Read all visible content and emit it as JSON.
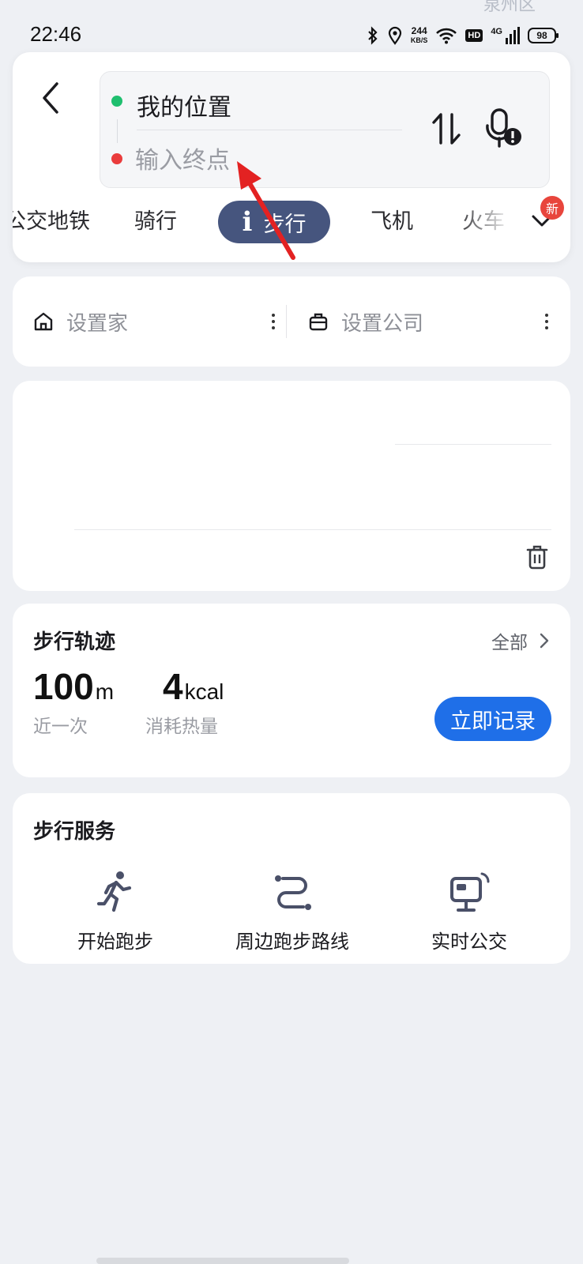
{
  "status_bar": {
    "time": "22:46",
    "speed_value": "244",
    "speed_unit": "KB/S",
    "hd": "HD",
    "network": "4G",
    "battery": "98"
  },
  "map_labels": [
    "泉州区"
  ],
  "route": {
    "from": "我的位置",
    "to_placeholder": "输入终点",
    "from_dot_color": "#1fbf6f",
    "to_dot_color": "#ea3c3c"
  },
  "tabs": {
    "items": [
      "公交地铁",
      "骑行",
      "步行",
      "飞机",
      "火车"
    ],
    "active": "步行",
    "new_badge": "新"
  },
  "shortcuts": {
    "home_label": "设置家",
    "company_label": "设置公司"
  },
  "walk_track": {
    "title": "步行轨迹",
    "view_all": "全部",
    "distance_value": "100",
    "distance_unit": "m",
    "distance_label": "近一次",
    "calories_value": "4",
    "calories_unit": "kcal",
    "calories_label": "消耗热量",
    "record_button": "立即记录"
  },
  "walk_services": {
    "title": "步行服务",
    "items": [
      {
        "label": "开始跑步",
        "icon": "running-icon"
      },
      {
        "label": "周边跑步路线",
        "icon": "route-icon"
      },
      {
        "label": "实时公交",
        "icon": "bus-stop-icon"
      }
    ]
  },
  "colors": {
    "accent_blue": "#1f6fe8",
    "active_tab": "#46557e",
    "annotation_arrow": "#e32222",
    "badge_red": "#e8453c"
  }
}
